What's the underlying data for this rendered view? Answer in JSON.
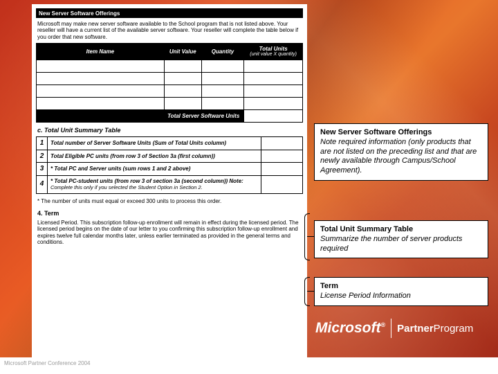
{
  "footer": "Microsoft Partner Conference 2004",
  "doc": {
    "offerings_header": "New Server Software Offerings",
    "offerings_para": "Microsoft may make new server software available to the School program that is not listed above. Your reseller will have a current list of the available server software. Your reseller will complete the table below if you order that new software.",
    "th_item": "Item Name",
    "th_unitvalue": "Unit Value",
    "th_qty": "Quantity",
    "th_total": "Total Units",
    "th_total_sub": "(unit value X quantity)",
    "total_row": "Total Server Software Units",
    "summary_label": "c.    Total Unit Summary Table",
    "s1": "Total number of Server Software Units (Sum of Total Units column)",
    "s2": "Total Eligible PC units (from row 3 of Section 3a (first column))",
    "s3": "* Total PC and Server units (sum rows 1 and 2 above)",
    "s4": "* Total PC-student units (from row 3 of section 3a (second column))  Note:",
    "s4note": "Complete this only if you selected the Student Option in Section 2.",
    "units_note": "*  The number of units must equal or exceed 300 units to process this order.",
    "term_hdr": "4.  Term",
    "term_body": "Licensed Period.  This subscription follow-up enrollment will remain in effect during the licensed period. The licensed period begins on the date of our letter to you confirming this subscription follow-up enrollment and expires twelve full calendar months later, unless earlier terminated as provided in the general terms and conditions."
  },
  "callouts": {
    "c1_title": "New Server Software Offerings",
    "c1_body": "Note required information (only products that are not listed on the preceding list and that are newly available through Campus/School Agreement).",
    "c2_title": "Total Unit Summary Table",
    "c2_body": "Summarize the number of server products required",
    "c3_title": "Term",
    "c3_body": "License Period Information"
  },
  "logo": {
    "ms": "Microsoft",
    "partner": "Partner",
    "program": "Program"
  }
}
